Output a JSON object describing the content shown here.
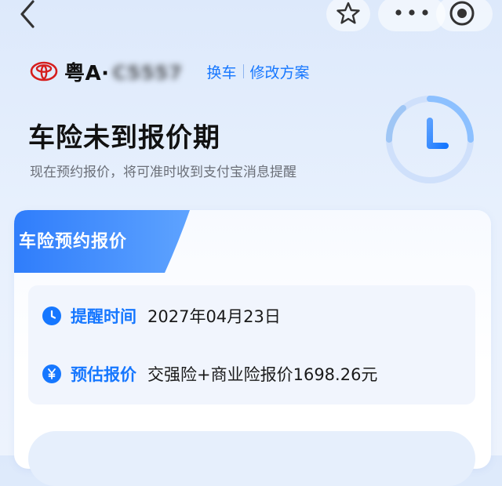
{
  "topbar": {
    "icons": [
      "back-icon",
      "star-icon",
      "more-icon",
      "target-icon"
    ]
  },
  "vehicle": {
    "plate_prefix": "粤A·",
    "plate_hidden": "C5557",
    "change_car": "换车",
    "modify_plan": "修改方案"
  },
  "headline": {
    "title": "车险未到报价期",
    "subtitle": "现在预约报价，将可准时收到支付宝消息提醒"
  },
  "card": {
    "tab_label": "车险预约报价",
    "rows": [
      {
        "icon": "clock-small-icon",
        "label": "提醒时间",
        "value": "2027年04月23日"
      },
      {
        "icon": "yen-icon",
        "label": "预估报价",
        "value": "交强险+商业险报价1698.26元"
      }
    ]
  },
  "colors": {
    "accent": "#1677ff",
    "background": "#e3edfc"
  }
}
